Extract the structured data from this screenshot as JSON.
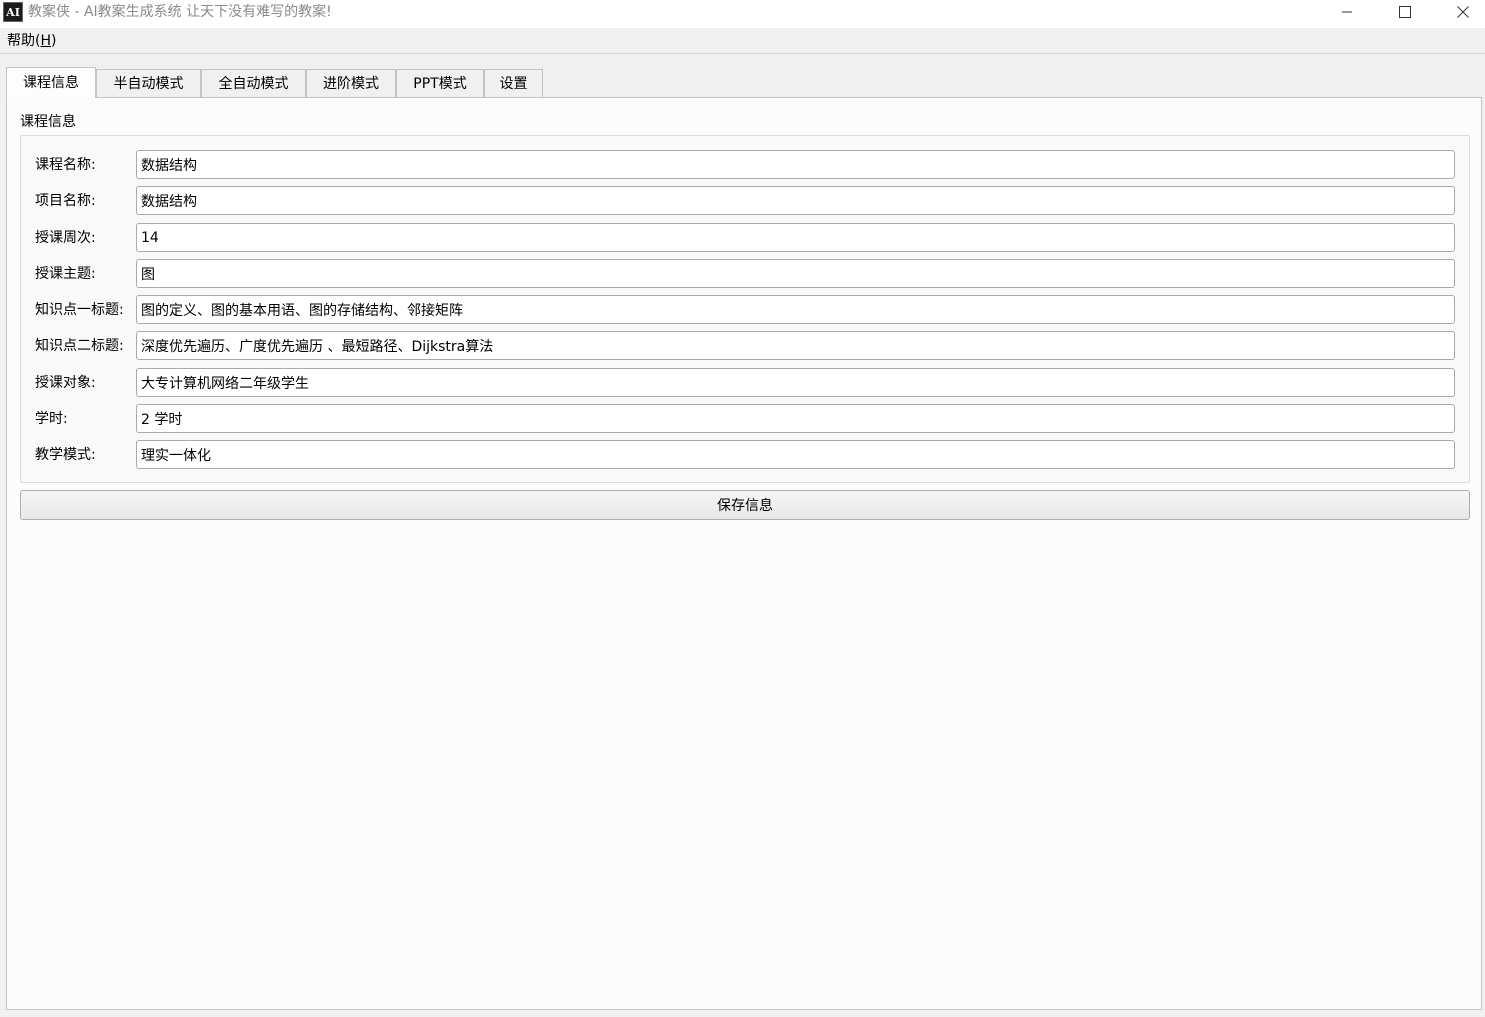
{
  "window": {
    "title": "教案侠 - AI教案生成系统   让天下没有难写的教案!",
    "icon": "app-logo-icon"
  },
  "menu": {
    "help_label": "帮助(",
    "help_mnemonic": "H",
    "help_close": ")"
  },
  "tabs": [
    {
      "label": "课程信息"
    },
    {
      "label": "半自动模式"
    },
    {
      "label": "全自动模式"
    },
    {
      "label": "进阶模式"
    },
    {
      "label": "PPT模式"
    },
    {
      "label": "设置"
    }
  ],
  "course": {
    "group_title": "课程信息",
    "fields": [
      {
        "label": "课程名称:",
        "value": "数据结构"
      },
      {
        "label": "项目名称:",
        "value": "数据结构"
      },
      {
        "label": "授课周次:",
        "value": "14"
      },
      {
        "label": "授课主题:",
        "value": "图"
      },
      {
        "label": "知识点一标题:",
        "value": "图的定义、图的基本用语、图的存储结构、邻接矩阵"
      },
      {
        "label": "知识点二标题:",
        "value": "深度优先遍历、广度优先遍历 、最短路径、Dijkstra算法"
      },
      {
        "label": "授课对象:",
        "value": "大专计算机网络二年级学生"
      },
      {
        "label": "学时:",
        "value": "2 学时"
      },
      {
        "label": "教学模式:",
        "value": "理实一体化"
      }
    ],
    "save_label": "保存信息"
  }
}
